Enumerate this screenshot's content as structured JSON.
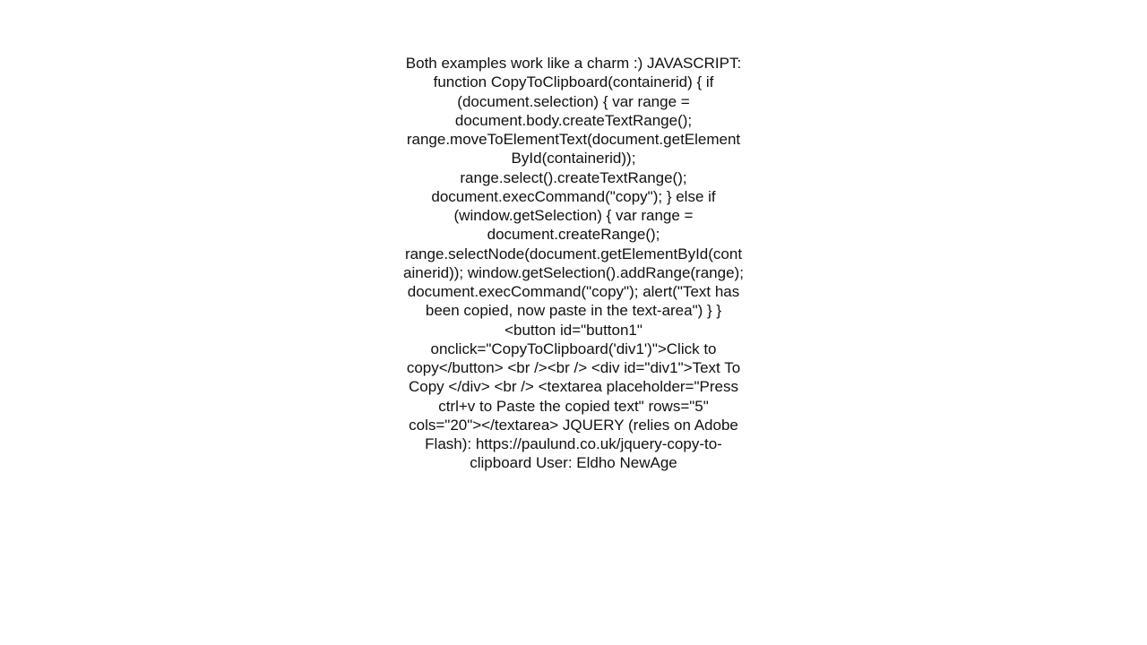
{
  "content": {
    "text": "Both examples work like a charm :)   JAVASCRIPT:   function CopyToClipboard(containerid) {    if (document.selection) {       var range = document.body.createTextRange();       range.moveToElementText(document.getElementById(containerid));      range.select().createTextRange();      document.execCommand(\"copy\");    } else if (window.getSelection) {       var range = document.createRange();       range.selectNode(document.getElementById(containerid));      window.getSelection().addRange(range);      document.execCommand(\"copy\");      alert(\"Text has been copied, now paste in the text-area\")    }  }  <button id=\"button1\" onclick=\"CopyToClipboard('div1')\">Click to copy</button>   <br /><br />   <div id=\"div1\">Text To Copy </div>   <br />  <textarea placeholder=\"Press ctrl+v to Paste the copied text\" rows=\"5\" cols=\"20\"></textarea>    JQUERY (relies on Adobe Flash): https://paulund.co.uk/jquery-copy-to-clipboard    User: Eldho NewAge"
  }
}
